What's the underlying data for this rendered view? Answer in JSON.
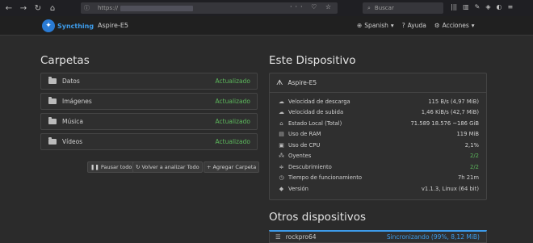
{
  "browser": {
    "url_prefix": "https://",
    "search_placeholder": "Buscar"
  },
  "navbar": {
    "brand": "Syncthing",
    "device": "Aspire-E5",
    "language": "Spanish",
    "help": "Ayuda",
    "actions": "Acciones"
  },
  "folders": {
    "title": "Carpetas",
    "items": [
      {
        "name": "Datos",
        "status": "Actualizado"
      },
      {
        "name": "Imágenes",
        "status": "Actualizado"
      },
      {
        "name": "Música",
        "status": "Actualizado"
      },
      {
        "name": "Vídeos",
        "status": "Actualizado"
      }
    ],
    "buttons": {
      "pause_all": "Pausar todo",
      "rescan_all": "Volver a analizar Todo",
      "add_folder": "Agregar Carpeta"
    }
  },
  "this_device": {
    "title": "Este Dispositivo",
    "name": "Aspire-E5",
    "rows": [
      {
        "icon": "cloud-download-icon",
        "label": "Velocidad de descarga",
        "value": "115 B/s (4,97 MiB)"
      },
      {
        "icon": "cloud-upload-icon",
        "label": "Velocidad de subida",
        "value": "1,46 KiB/s (42,7 MiB)"
      },
      {
        "icon": "home-icon",
        "label": "Estado Local (Total)",
        "value": "71.589  18.576  ~186 GiB"
      },
      {
        "icon": "ram-icon",
        "label": "Uso de RAM",
        "value": "119 MiB"
      },
      {
        "icon": "cpu-icon",
        "label": "Uso de CPU",
        "value": "2,1%"
      },
      {
        "icon": "sitemap-icon",
        "label": "Oyentes",
        "value": "2/2"
      },
      {
        "icon": "discovery-icon",
        "label": "Descubrimiento",
        "value": "2/2"
      },
      {
        "icon": "clock-icon",
        "label": "Tiempo de funcionamiento",
        "value": "7h 21m"
      },
      {
        "icon": "tag-icon",
        "label": "Versión",
        "value": "v1.1.3, Linux (64 bit)"
      }
    ]
  },
  "other_devices": {
    "title": "Otros dispositivos",
    "items": [
      {
        "name": "rockpro64",
        "status": "Sincronizando (99%, 8,12 MiB)"
      }
    ]
  },
  "colors": {
    "accent": "#3d9be9",
    "success": "#5cb85c",
    "background": "#2b2b2b"
  }
}
